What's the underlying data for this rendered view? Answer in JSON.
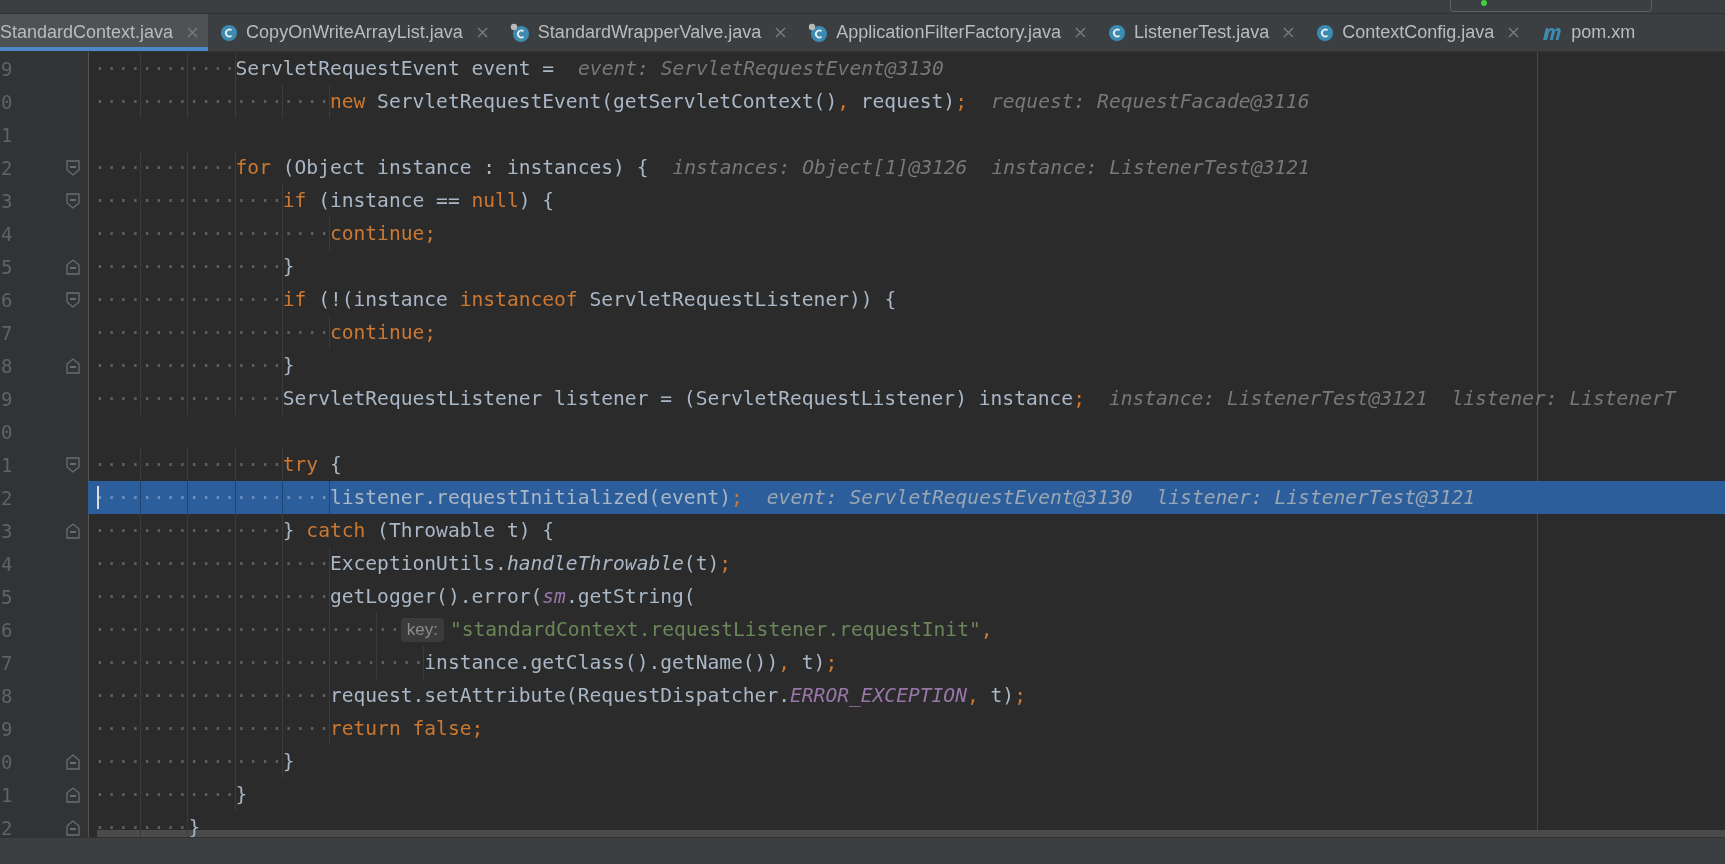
{
  "tabs": [
    {
      "label": "StandardContext.java",
      "kind": "plain",
      "selected": true
    },
    {
      "label": "CopyOnWriteArrayList.java",
      "kind": "class",
      "selected": false
    },
    {
      "label": "StandardWrapperValve.java",
      "kind": "class-badge",
      "selected": false
    },
    {
      "label": "ApplicationFilterFactory.java",
      "kind": "class-badge",
      "selected": false
    },
    {
      "label": "ListenerTest.java",
      "kind": "class",
      "selected": false
    },
    {
      "label": "ContextConfig.java",
      "kind": "class",
      "selected": false
    },
    {
      "label": "pom.xm",
      "kind": "maven",
      "selected": false,
      "close": false
    }
  ],
  "lines": [
    {
      "number": "9",
      "selected": false,
      "kind": "plain",
      "indent": "············",
      "tokens": [
        {
          "kind": "plain",
          "text": "ServletRequestEvent event ="
        },
        {
          "kind": "hint",
          "text": "event: ServletRequestEvent@3130"
        }
      ]
    },
    {
      "number": "0",
      "selected": false,
      "kind": "plain",
      "indent": "····················",
      "tokens": [
        {
          "kind": "keyword",
          "text": "new"
        },
        {
          "kind": "plain",
          "text": " ServletRequestEvent(getServletContext()"
        },
        {
          "kind": "keyword",
          "text": ","
        },
        {
          "kind": "plain",
          "text": " request)"
        },
        {
          "kind": "keyword",
          "text": ";"
        },
        {
          "kind": "hint",
          "text": "request: RequestFacade@3116"
        }
      ]
    },
    {
      "number": "1",
      "selected": false,
      "kind": "plain"
    },
    {
      "number": "2",
      "selected": false,
      "kind": "fold-start",
      "indent": "············",
      "tokens": [
        {
          "kind": "keyword",
          "text": "for"
        },
        {
          "kind": "plain",
          "text": " (Object instance : instances) {"
        },
        {
          "kind": "hint",
          "text": "instances: Object[1]@3126"
        },
        {
          "kind": "hint",
          "text": "instance: ListenerTest@3121"
        }
      ]
    },
    {
      "number": "3",
      "selected": false,
      "kind": "fold-start",
      "indent": "················",
      "tokens": [
        {
          "kind": "keyword",
          "text": "if"
        },
        {
          "kind": "plain",
          "text": " (instance == "
        },
        {
          "kind": "keyword",
          "text": "null"
        },
        {
          "kind": "plain",
          "text": ") {"
        }
      ]
    },
    {
      "number": "4",
      "selected": false,
      "kind": "plain",
      "indent": "····················",
      "tokens": [
        {
          "kind": "keyword",
          "text": "continue;"
        }
      ]
    },
    {
      "number": "5",
      "selected": false,
      "kind": "fold-end",
      "indent": "················",
      "tokens": [
        {
          "kind": "plain",
          "text": "}"
        }
      ]
    },
    {
      "number": "6",
      "selected": false,
      "kind": "fold-start",
      "indent": "················",
      "tokens": [
        {
          "kind": "keyword",
          "text": "if"
        },
        {
          "kind": "plain",
          "text": " (!(instance "
        },
        {
          "kind": "keyword",
          "text": "instanceof"
        },
        {
          "kind": "plain",
          "text": " ServletRequestListener)) {"
        }
      ]
    },
    {
      "number": "7",
      "selected": false,
      "kind": "plain",
      "indent": "····················",
      "tokens": [
        {
          "kind": "keyword",
          "text": "continue;"
        }
      ]
    },
    {
      "number": "8",
      "selected": false,
      "kind": "fold-end",
      "indent": "················",
      "tokens": [
        {
          "kind": "plain",
          "text": "}"
        }
      ]
    },
    {
      "number": "9",
      "selected": false,
      "kind": "plain",
      "indent": "················",
      "tokens": [
        {
          "kind": "plain",
          "text": "ServletRequestListener listener = (ServletRequestListener) instance"
        },
        {
          "kind": "keyword",
          "text": ";"
        },
        {
          "kind": "hint",
          "text": "instance: ListenerTest@3121"
        },
        {
          "kind": "hint",
          "text": "listener: ListenerT"
        }
      ]
    },
    {
      "number": "0",
      "selected": false,
      "kind": "plain"
    },
    {
      "number": "1",
      "selected": false,
      "kind": "fold-start",
      "indent": "················",
      "tokens": [
        {
          "kind": "keyword",
          "text": "try"
        },
        {
          "kind": "plain",
          "text": " {"
        }
      ]
    },
    {
      "number": "2",
      "selected": true,
      "kind": "plain",
      "indent": "····················",
      "tokens": [
        {
          "kind": "plain",
          "text": "listener.requestInitialized(event)"
        },
        {
          "kind": "keyword",
          "text": ";"
        },
        {
          "kind": "hint",
          "text": "event: ServletRequestEvent@3130"
        },
        {
          "kind": "hint",
          "text": "listener: ListenerTest@3121"
        }
      ]
    },
    {
      "number": "3",
      "selected": false,
      "kind": "fold-end",
      "indent": "················",
      "tokens": [
        {
          "kind": "plain",
          "text": "} "
        },
        {
          "kind": "keyword",
          "text": "catch"
        },
        {
          "kind": "plain",
          "text": " (Throwable t) {"
        }
      ]
    },
    {
      "number": "4",
      "selected": false,
      "kind": "plain",
      "indent": "····················",
      "tokens": [
        {
          "kind": "plain",
          "text": "ExceptionUtils."
        },
        {
          "kind": "method-static",
          "text": "handleThrowable"
        },
        {
          "kind": "plain",
          "text": "(t)"
        },
        {
          "kind": "keyword",
          "text": ";"
        }
      ]
    },
    {
      "number": "5",
      "selected": false,
      "kind": "plain",
      "indent": "····················",
      "tokens": [
        {
          "kind": "plain",
          "text": "getLogger().error("
        },
        {
          "kind": "field-static",
          "text": "sm"
        },
        {
          "kind": "plain",
          "text": ".getString("
        }
      ]
    },
    {
      "number": "6",
      "selected": false,
      "kind": "plain",
      "indent": "··························",
      "tokens": [
        {
          "kind": "param-hint",
          "text": "key:"
        },
        {
          "kind": "string",
          "text": "\"standardContext.requestListener.requestInit\""
        },
        {
          "kind": "keyword",
          "text": ","
        }
      ]
    },
    {
      "number": "7",
      "selected": false,
      "kind": "plain",
      "indent": "····························",
      "tokens": [
        {
          "kind": "plain",
          "text": "instance.getClass().getName())"
        },
        {
          "kind": "keyword",
          "text": ","
        },
        {
          "kind": "plain",
          "text": " t)"
        },
        {
          "kind": "keyword",
          "text": ";"
        }
      ]
    },
    {
      "number": "8",
      "selected": false,
      "kind": "plain",
      "indent": "····················",
      "tokens": [
        {
          "kind": "plain",
          "text": "request.setAttribute(RequestDispatcher."
        },
        {
          "kind": "field-static",
          "text": "ERROR_EXCEPTION"
        },
        {
          "kind": "keyword",
          "text": ","
        },
        {
          "kind": "plain",
          "text": " t)"
        },
        {
          "kind": "keyword",
          "text": ";"
        }
      ]
    },
    {
      "number": "9",
      "selected": false,
      "kind": "plain",
      "indent": "····················",
      "tokens": [
        {
          "kind": "keyword",
          "text": "return false;"
        }
      ]
    },
    {
      "number": "0",
      "selected": false,
      "kind": "fold-end",
      "indent": "················",
      "tokens": [
        {
          "kind": "plain",
          "text": "}"
        }
      ]
    },
    {
      "number": "1",
      "selected": false,
      "kind": "fold-end",
      "indent": "············",
      "tokens": [
        {
          "kind": "plain",
          "text": "}"
        }
      ]
    },
    {
      "number": "2",
      "selected": false,
      "kind": "fold-end",
      "indent": "········",
      "tokens": [
        {
          "kind": "plain",
          "text": "}"
        }
      ]
    }
  ]
}
